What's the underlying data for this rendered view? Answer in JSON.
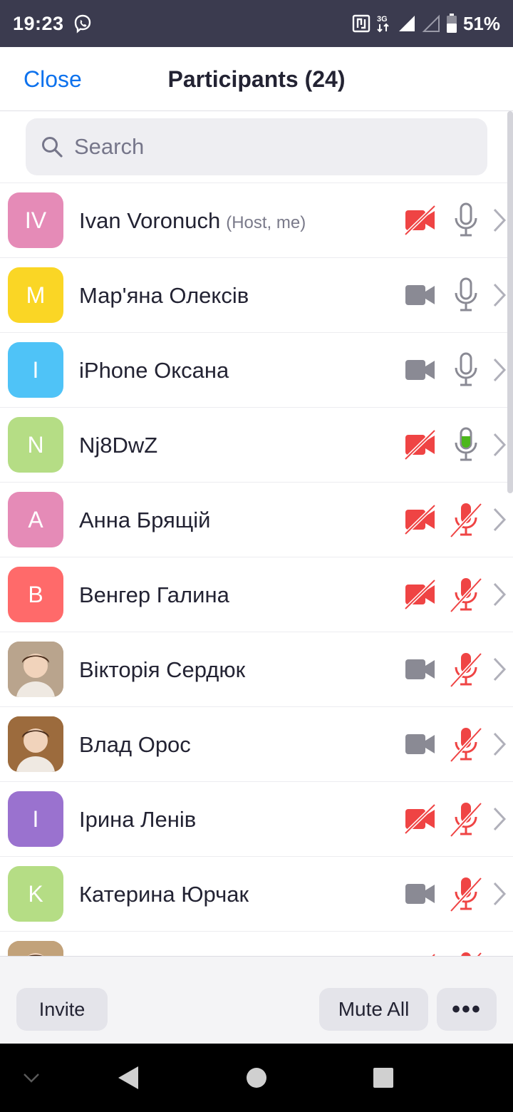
{
  "status_bar": {
    "time": "19:23",
    "network_label": "3G",
    "battery_percent": "51%"
  },
  "header": {
    "close_label": "Close",
    "title": "Participants (24)"
  },
  "search": {
    "placeholder": "Search"
  },
  "participants": [
    {
      "initials": "IV",
      "name": "Ivan Voronuch",
      "role": "(Host, me)",
      "avatar_color": "#e58bb7",
      "video": "off",
      "audio": "on"
    },
    {
      "initials": "M",
      "name": "Мар'яна Олексів",
      "role": "",
      "avatar_color": "#fad625",
      "video": "on",
      "audio": "on"
    },
    {
      "initials": "I",
      "name": "iPhone Оксана",
      "role": "",
      "avatar_color": "#4fc3f7",
      "video": "on",
      "audio": "on"
    },
    {
      "initials": "N",
      "name": "Nj8DwZ",
      "role": "",
      "avatar_color": "#b5dd85",
      "video": "off",
      "audio": "speaking"
    },
    {
      "initials": "A",
      "name": "Анна Брящій",
      "role": "",
      "avatar_color": "#e58bb7",
      "video": "off",
      "audio": "muted"
    },
    {
      "initials": "B",
      "name": "Венгер Галина",
      "role": "",
      "avatar_color": "#ff6a6a",
      "video": "off",
      "audio": "muted"
    },
    {
      "initials": "",
      "name": "Вікторія Сердюк",
      "role": "",
      "avatar_color": "#b9a48d",
      "photo": true,
      "video": "on",
      "audio": "muted"
    },
    {
      "initials": "",
      "name": "Влад Орос",
      "role": "",
      "avatar_color": "#9c6b3d",
      "photo": true,
      "video": "on",
      "audio": "muted"
    },
    {
      "initials": "I",
      "name": "Ірина Ленів",
      "role": "",
      "avatar_color": "#9a72cf",
      "video": "off",
      "audio": "muted"
    },
    {
      "initials": "K",
      "name": "Катерина Юрчак",
      "role": "",
      "avatar_color": "#b5dd85",
      "video": "on",
      "audio": "muted"
    },
    {
      "initials": "",
      "name": "",
      "role": "",
      "avatar_color": "#c2a27a",
      "photo": true,
      "video": "off",
      "audio": "muted"
    }
  ],
  "toolbar": {
    "invite_label": "Invite",
    "mute_all_label": "Mute All",
    "more_label": "•••"
  },
  "colors": {
    "accent": "#0e72ed",
    "muted_red": "#ef4444",
    "speaking_green": "#4cb71b",
    "icon_gray": "#8a8a94"
  },
  "icons": {
    "video_on": "video-camera-icon",
    "video_off": "video-camera-off-icon",
    "mic_on": "microphone-icon",
    "mic_muted": "microphone-muted-icon",
    "row_chevron": "chevron-right-icon"
  }
}
